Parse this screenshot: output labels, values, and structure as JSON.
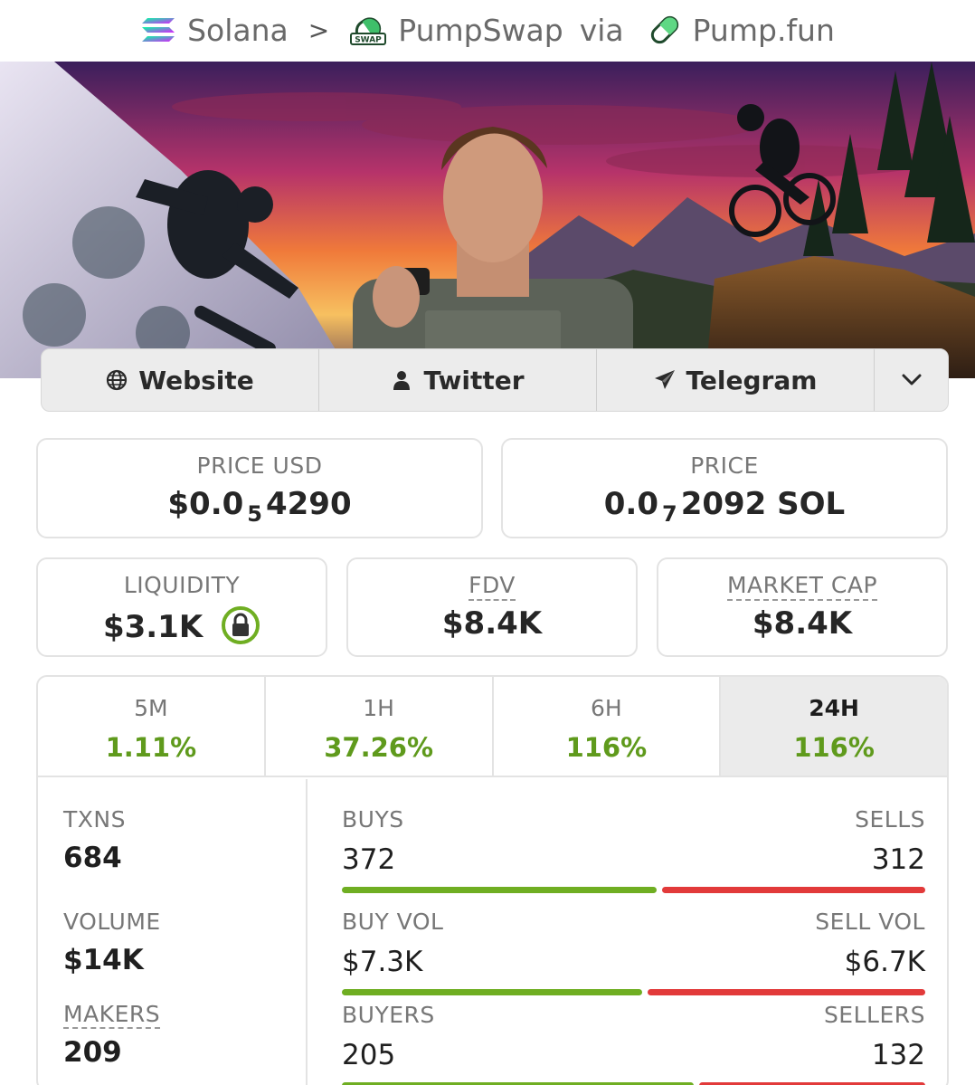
{
  "breadcrumb": {
    "chain": "Solana",
    "separator": ">",
    "dex": "PumpSwap",
    "swap_badge": "SWAP",
    "via": "via",
    "launchpad": "Pump.fun"
  },
  "links": {
    "website": "Website",
    "twitter": "Twitter",
    "telegram": "Telegram"
  },
  "price_usd": {
    "label": "PRICE USD",
    "prefix": "$0.0",
    "zeros": "5",
    "digits": "4290"
  },
  "price_native": {
    "label": "PRICE",
    "prefix": "0.0",
    "zeros": "7",
    "digits": "2092 SOL"
  },
  "liquidity": {
    "label": "LIQUIDITY",
    "value": "$3.1K"
  },
  "fdv": {
    "label": "FDV",
    "value": "$8.4K"
  },
  "market_cap": {
    "label": "MARKET CAP",
    "value": "$8.4K"
  },
  "timeframes": [
    {
      "label": "5M",
      "change": "1.11%"
    },
    {
      "label": "1H",
      "change": "37.26%"
    },
    {
      "label": "6H",
      "change": "116%"
    },
    {
      "label": "24H",
      "change": "116%"
    }
  ],
  "active_timeframe": "24H",
  "txns": {
    "label": "TXNS",
    "value": "684"
  },
  "volume": {
    "label": "VOLUME",
    "value": "$14K"
  },
  "makers": {
    "label": "MAKERS",
    "value": "209"
  },
  "buys_sells": {
    "left_label": "BUYS",
    "right_label": "SELLS",
    "left": "372",
    "right": "312",
    "buy_share": 0.544
  },
  "buy_sell_vol": {
    "left_label": "BUY VOL",
    "right_label": "SELL VOL",
    "left": "$7.3K",
    "right": "$6.7K",
    "buy_share": 0.52
  },
  "buyers_sellers": {
    "left_label": "BUYERS",
    "right_label": "SELLERS",
    "left": "205",
    "right": "132",
    "buy_share": 0.608
  },
  "colors": {
    "positive": "#5f9a1c",
    "buy_bar": "#6fae22",
    "sell_bar": "#e23a3a",
    "lock": "#6fae22"
  }
}
